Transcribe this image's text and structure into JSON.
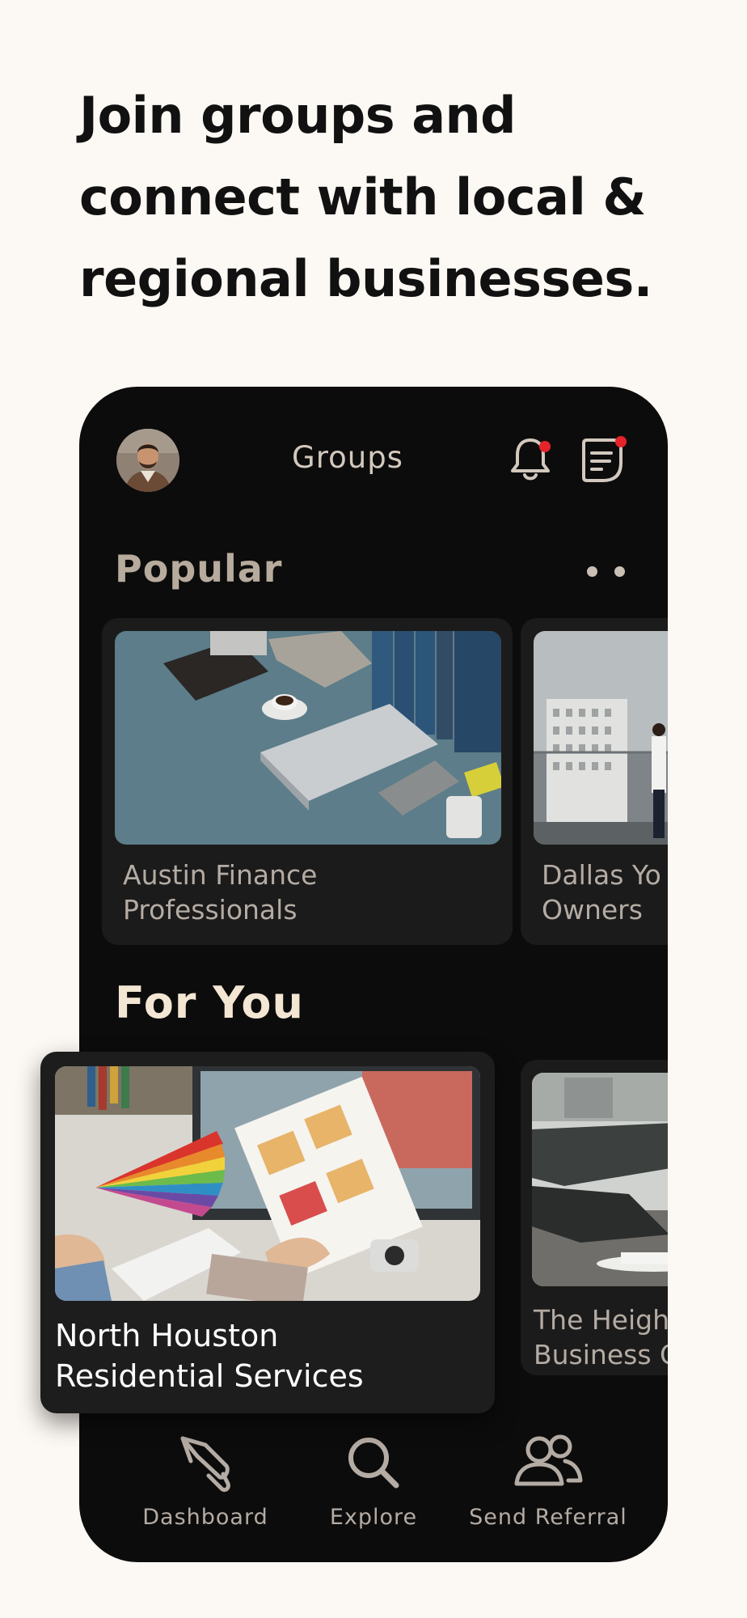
{
  "headline": {
    "line1": "Join groups and",
    "line2": "connect with local &",
    "line3": "regional businesses."
  },
  "topbar": {
    "title": "Groups",
    "avatar": "user-avatar",
    "icons": [
      "bell-icon",
      "chat-icon"
    ],
    "notification_dot_color": "#e5242a"
  },
  "popular": {
    "heading": "Popular",
    "cards": [
      {
        "line1": "Austin Finance",
        "line2": "Professionals"
      },
      {
        "line1": "Dallas Yo",
        "line2": "Owners"
      }
    ]
  },
  "for_you": {
    "heading": "For You",
    "cards": [
      {
        "line1": "North Houston",
        "line2": "Residential Services"
      },
      {
        "line1": "The Heigh",
        "line2": "Business C"
      }
    ]
  },
  "bottom_nav": {
    "items": [
      {
        "label": "Dashboard",
        "icon": "rocket-icon"
      },
      {
        "label": "Explore",
        "icon": "search-icon"
      },
      {
        "label": "Send Referral",
        "icon": "users-icon"
      }
    ]
  },
  "colors": {
    "page_bg": "#fcf8f3",
    "phone_bg": "#0d0c0c",
    "card_bg": "#1c1b1b",
    "accent_beige": "#d2c8bd"
  }
}
